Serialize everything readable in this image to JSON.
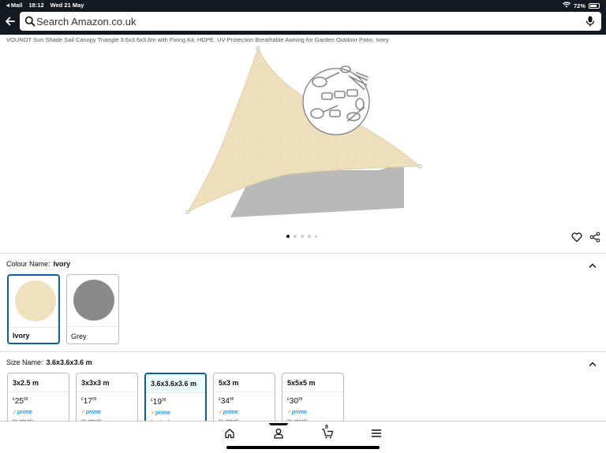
{
  "status_bar": {
    "app": "◂ Mail",
    "time": "18:12",
    "date": "Wed 21 May",
    "battery": "72%"
  },
  "search": {
    "placeholder": "Search Amazon.co.uk"
  },
  "product": {
    "title": "VOUNOT Sun Shade Sail Canopy Triangle 3.6x3.6x3.6m with Fixing Kit, HDPE, UV-Protection Breathable Awning for Garden Outdoor Patio, Ivory",
    "image_count": 5,
    "image_index": 1
  },
  "colour": {
    "label": "Colour Name:",
    "selected": "Ivory",
    "options": [
      {
        "name": "Ivory",
        "color": "#efe1bd"
      },
      {
        "name": "Grey",
        "color": "#8a8a8a"
      }
    ]
  },
  "size": {
    "label": "Size Name:",
    "selected": "3.6x3.6x3.6 m",
    "options": [
      {
        "name": "3x2.5 m",
        "price_whole": "25",
        "price_frac": "99",
        "prime": "prime",
        "stock": "In stock"
      },
      {
        "name": "3x3x3 m",
        "price_whole": "17",
        "price_frac": "99",
        "prime": "prime",
        "stock": "In stock"
      },
      {
        "name": "3.6x3.6x3.6 m",
        "price_whole": "19",
        "price_frac": "99",
        "prime": "prime",
        "stock": "In stock"
      },
      {
        "name": "5x3 m",
        "price_whole": "34",
        "price_frac": "99",
        "prime": "prime",
        "stock": "In stock"
      },
      {
        "name": "5x5x5 m",
        "price_whole": "30",
        "price_frac": "99",
        "prime": "prime",
        "stock": "In stock"
      }
    ],
    "currency": "£"
  },
  "nav": {
    "cart_count": "8"
  },
  "colors": {
    "header": "#131921",
    "selected_border": "#0a5fa8",
    "prime_blue": "#1a98ff",
    "in_stock": "#007600"
  },
  "icons": [
    "back-arrow-icon",
    "search-icon",
    "microphone-icon",
    "heart-icon",
    "share-icon",
    "chevron-up-icon",
    "home-icon",
    "account-icon",
    "cart-icon",
    "menu-icon"
  ]
}
